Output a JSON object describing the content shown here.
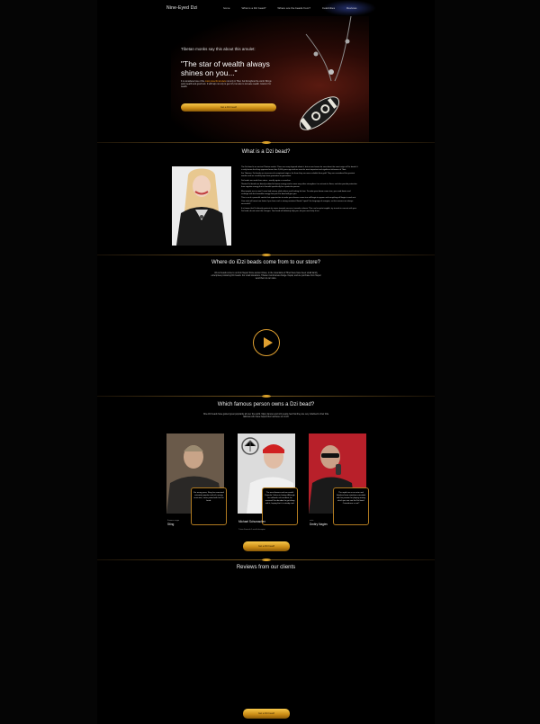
{
  "header": {
    "brand": "Nine-Eyed Dzi",
    "nav": [
      "home",
      "What is a Dzi bead?",
      "Where are the beads from?",
      "Celebrities",
      "Reviews"
    ]
  },
  "hero": {
    "intro": "Tibetan monks say this about this amulet:",
    "quote": "\"The star of wealth always shines on you...\"",
    "text_start": "It is considered one of the ",
    "text_highlight": "most powerful amulets",
    "text_end": " not only in Tibet, but throughout the world. Brings quick wealth and good luck. It will help not only to get rich, but also to increase wealth. Grants it for wealth.",
    "button": "Get a Dzi bead!"
  },
  "what_is": {
    "title": "What is a Dzi bead?",
    "paragraphs": [
      "The Dzi bead is an ancient Tibetan amulet. There are many legends about it, but no one knows for sure about the exact origin of Dzi beads. It is only known that they appeared more than 2,000 years ago and are now the most important and significant talismans of Tibet.",
      "For Tibetans, Dzi beads are treasures of exceptional origins, for them they are more valuable than gold. They are considered the greatest wonder and are carefully kept from generation to generation.",
      "Dzi beads are made from stone - usually agate or carnelian.",
      "Tibetan Dzi beads are directly related to human energy and in some way either strengthen it or activate its flows, and also provide protection from negative energy that is harmful specifically for a particular person.",
      "Most people are in need. Loose bad money, while others work looking for love. To make your dream come true, you need desire and recharge with the favorable energy that your Dzi bead will give you.",
      "This is such a powerful amulet that opportunities to make your dreams come true will begin to appear and everything will begin to work out.",
      "Your wish will come true faster if you have such a strong assistant. Beads \"speak\" the language of energies, so their owners are always successful!",
      "It is known that Dzi directly protects its owner towards success, towards a dream. This can be quite tangible, try to work in concert with your Dzi bead, do not resist the changes. Your bead will definitely help you, but you must help it too."
    ]
  },
  "where": {
    "title": "Where do iDzi beads come from to our store?",
    "text": "All our beads come to us from Nepal. Since ancient times, in the mountains of Tibet there have been small family enterprises producing Dzi beads. For small donations, Tibetan monk lamas charge. Nepal, and we purchase from Nepal send them to our store."
  },
  "famous": {
    "title": "Which famous person owns a Dzi bead?",
    "subtitle": "Nine-Dzi beads have gained great popularity all over the world. Many famous and rich people feel that they are very indebted to their little talisman who have helped them achieve so much!",
    "button": "Get a Dzi bead!",
    "people": [
      {
        "role": "Famous singer",
        "name": "Sting",
        "quote": "For many years, Sting has remained extremely popular and rich among musicians, never parted with his Dzi bead."
      },
      {
        "role": "",
        "name": "Michael Schumacher",
        "role2": "7-time Formula 1 world champion",
        "quote": "The most famous and successful Formula 1 driver in history. Although he suffered a ski accident, he survived. For decades he got along with it, hoping that it is steady now!"
      },
      {
        "role": "actor",
        "name": "Dmitry Nagiev",
        "quote": "The rapid rise as an actor and fabulous fame somehow coincided with his passion for playing among which you can see the Dzi bead. Coincidence or not?"
      }
    ]
  },
  "reviews": {
    "title": "Reviews from our clients",
    "button": "Get a Dzi bead!"
  },
  "colors": {
    "accent": "#e0a030",
    "background": "#000000"
  }
}
